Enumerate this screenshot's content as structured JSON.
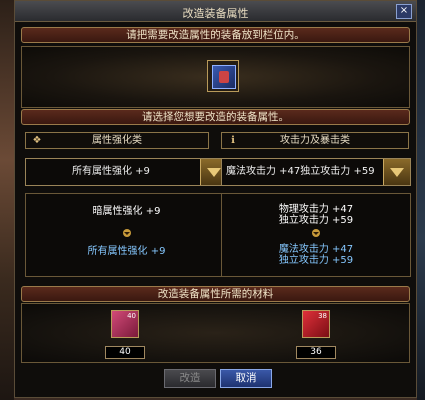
{
  "window": {
    "title": "改造装备属性",
    "close_label": "×"
  },
  "section1": {
    "header": "请把需要改造属性的装备放到栏位内。"
  },
  "section2": {
    "header": "请选择您想要改造的装备属性。"
  },
  "left_column": {
    "header": "属性强化类",
    "dropdown_value": "所有属性强化 +9",
    "preview_current": "暗属性强化 +9",
    "preview_result": "所有属性强化 +9"
  },
  "right_column": {
    "header": "攻击力及暴击类",
    "dropdown_value": "魔法攻击力 +47独立攻击力 +59",
    "preview_current_1": "物理攻击力 +47",
    "preview_current_2": "独立攻击力 +59",
    "preview_result_1": "魔法攻击力 +47",
    "preview_result_2": "独立攻击力 +59"
  },
  "materials": {
    "header": "改造装备属性所需的材料",
    "items": [
      {
        "slot_label": "40",
        "count": "40",
        "color": "#b02a5a"
      },
      {
        "slot_label": "38",
        "count": "36",
        "color": "#c01e2a"
      }
    ]
  },
  "buttons": {
    "modify": "改造",
    "cancel": "取消"
  }
}
